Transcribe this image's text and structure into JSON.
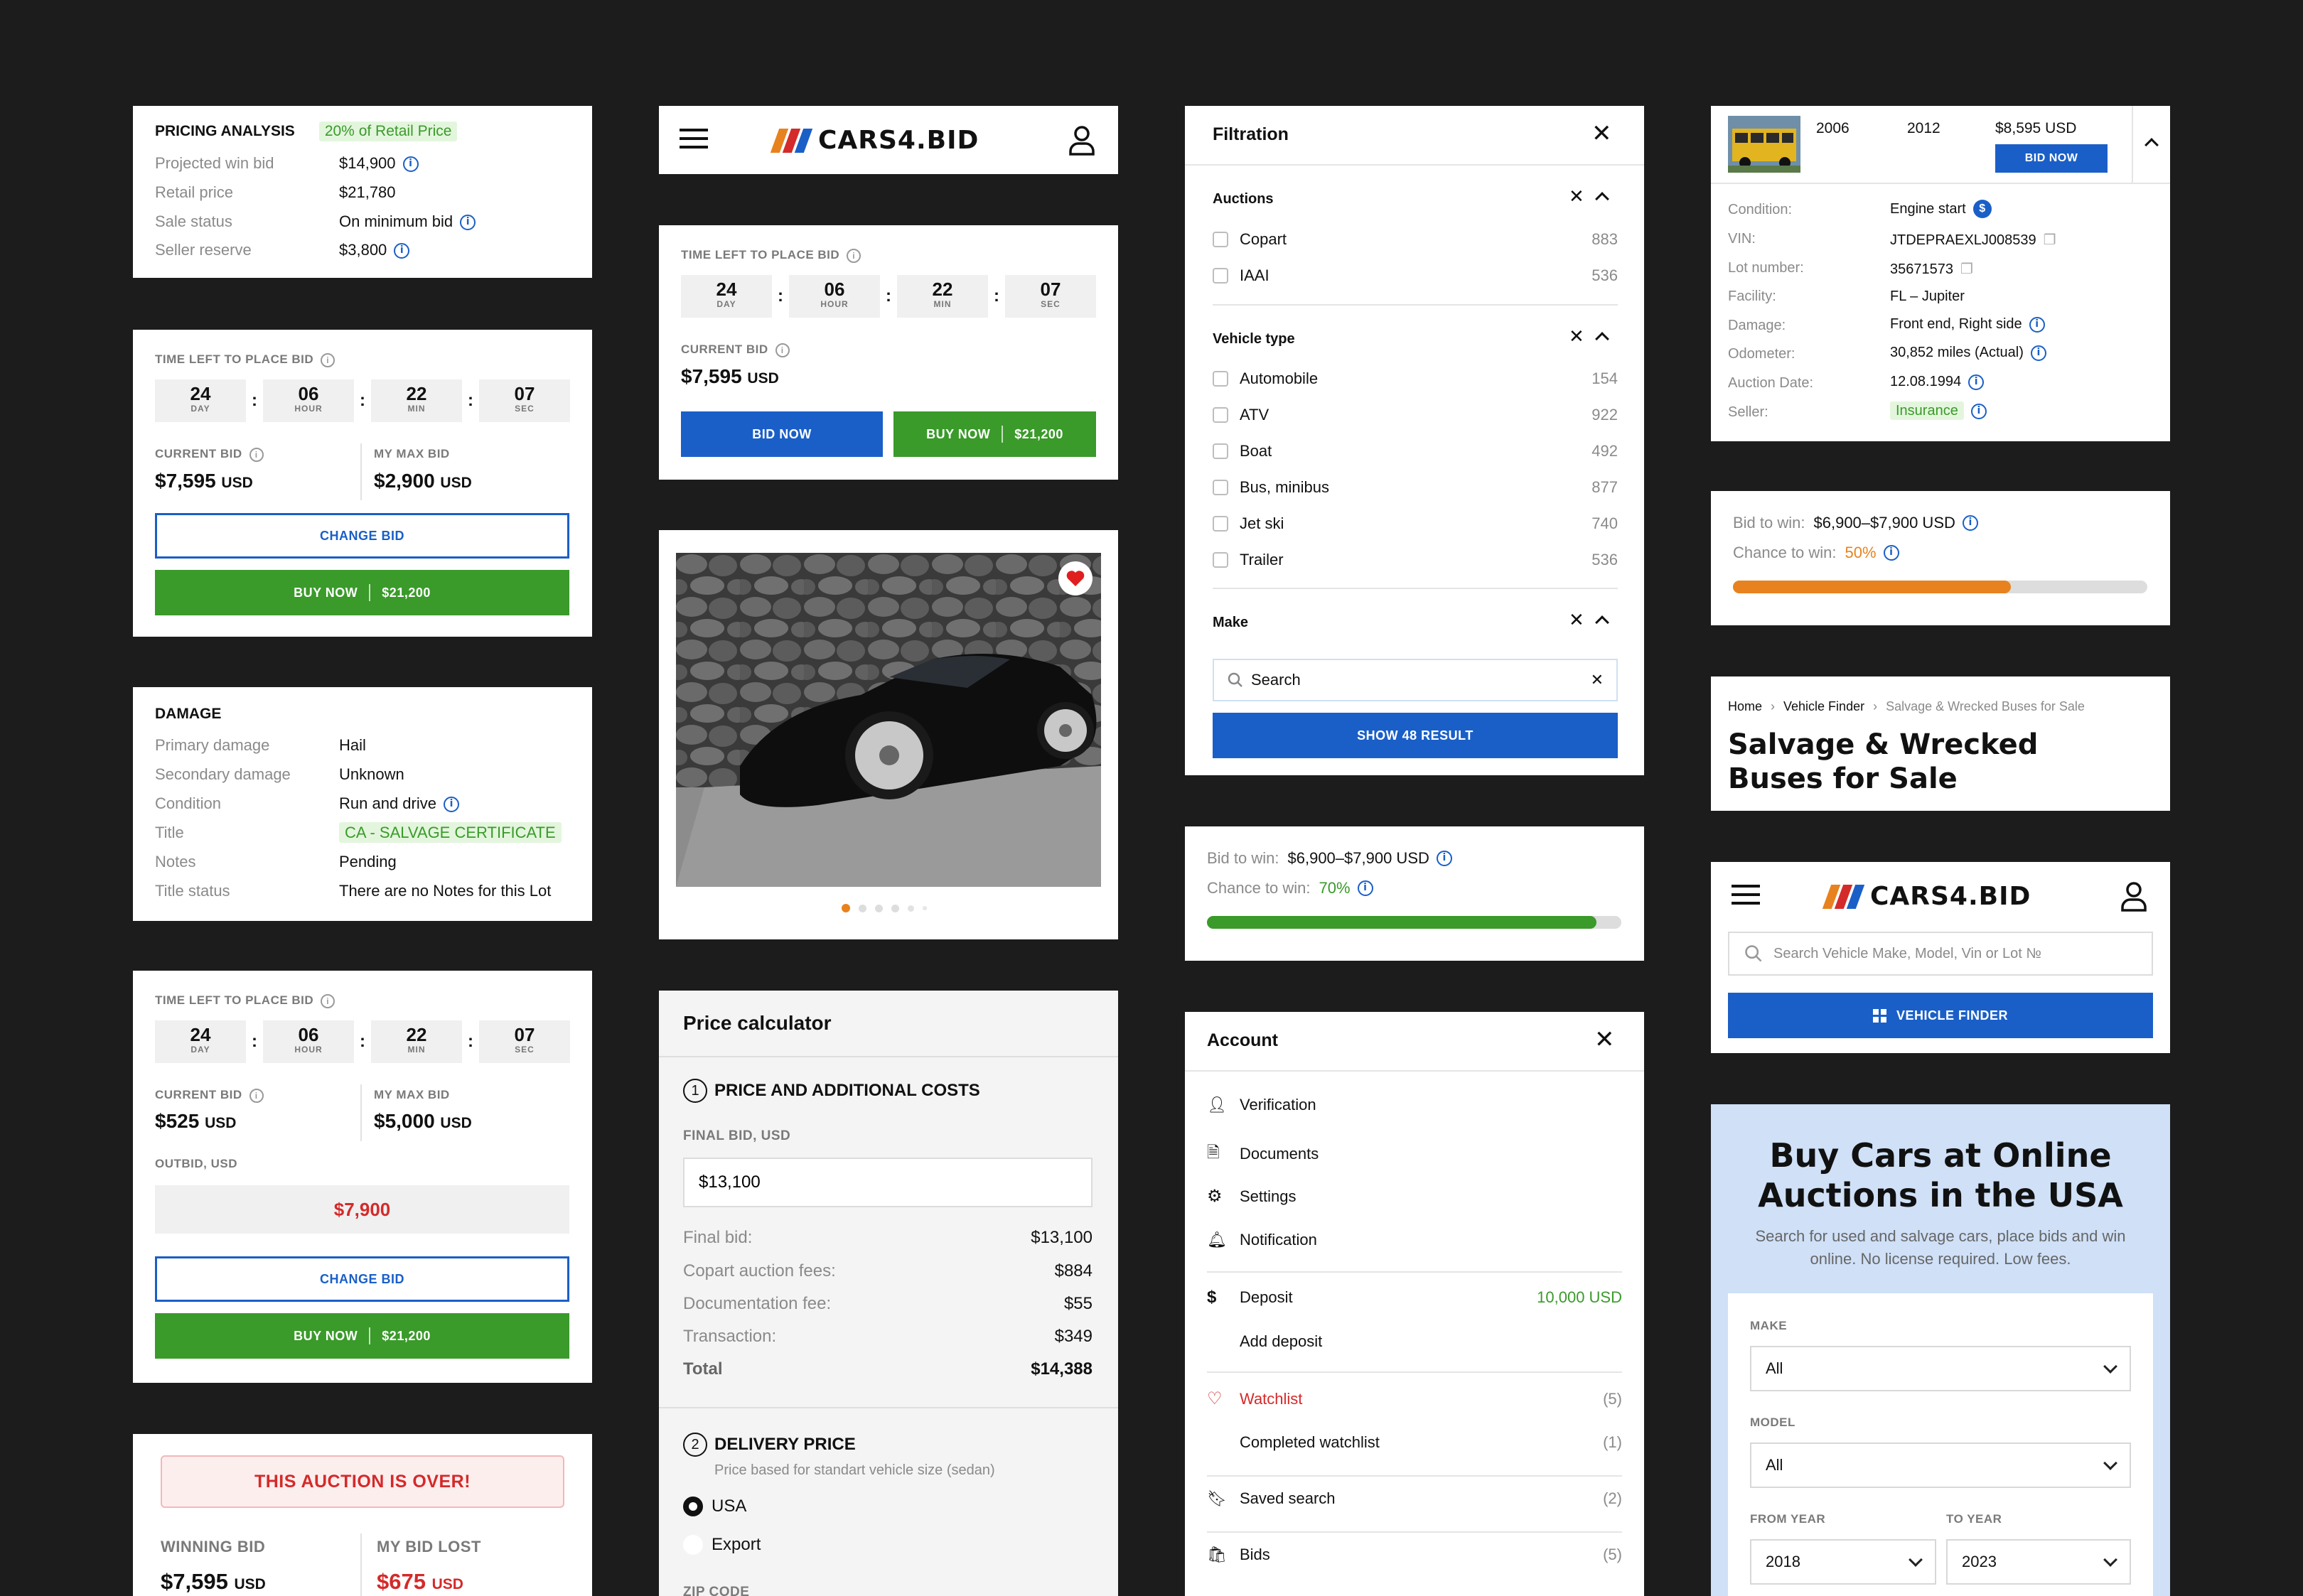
{
  "pricing": {
    "title": "PRICING ANALYSIS",
    "badge": "20% of Retail Price",
    "rows": [
      {
        "k": "Projected win bid",
        "v": "$14,900"
      },
      {
        "k": "Retail price",
        "v": "$21,780"
      },
      {
        "k": "Sale status",
        "v": "On minimum bid"
      },
      {
        "k": "Seller reserve",
        "v": "$3,800"
      }
    ]
  },
  "timer1": {
    "label": "TIME LEFT TO PLACE BID",
    "day": "24",
    "hour": "06",
    "min": "22",
    "sec": "07",
    "u_day": "DAY",
    "u_hour": "HOUR",
    "u_min": "MIN",
    "u_sec": "SEC",
    "current_label": "CURRENT BID",
    "current": "$7,595",
    "max_label": "MY MAX BID",
    "max": "$2,900",
    "cur": "USD",
    "change": "CHANGE BID",
    "buy": "BUY NOW",
    "buy_price": "$21,200"
  },
  "damage": {
    "title": "DAMAGE",
    "rows": [
      {
        "k": "Primary damage",
        "v": "Hail"
      },
      {
        "k": "Secondary damage",
        "v": "Unknown"
      },
      {
        "k": "Condition",
        "v": "Run and drive"
      },
      {
        "k": "Title",
        "v": "CA - SALVAGE CERTIFICATE"
      },
      {
        "k": "Notes",
        "v": "Pending"
      },
      {
        "k": "Title status",
        "v": "There are no Notes for this Lot"
      }
    ]
  },
  "timer2": {
    "label": "TIME LEFT TO PLACE BID",
    "day": "24",
    "hour": "06",
    "min": "22",
    "sec": "07",
    "current_label": "CURRENT BID",
    "current": "$525",
    "max_label": "MY MAX BID",
    "max": "$5,000",
    "cur": "USD",
    "outbid_label": "OUTBID, USD",
    "outbid": "$7,900",
    "change": "CHANGE BID",
    "buy": "BUY NOW",
    "buy_price": "$21,200"
  },
  "over": {
    "banner": "THIS AUCTION IS OVER!",
    "winning_label": "WINNING BID",
    "winning": "$7,595",
    "lost_label": "MY BID LOST",
    "lost": "$675",
    "cur": "USD"
  },
  "header1": {
    "logo": "CARS4.BID"
  },
  "timer3": {
    "label": "TIME LEFT TO PLACE BID",
    "day": "24",
    "hour": "06",
    "min": "22",
    "sec": "07",
    "current_label": "CURRENT BID",
    "current": "$7,595",
    "cur": "USD",
    "bid": "BID NOW",
    "buy": "BUY NOW",
    "buy_price": "$21,200"
  },
  "calc": {
    "title": "Price calculator",
    "s1num": "1",
    "s1": "PRICE AND ADDITIONAL COSTS",
    "final_label": "FINAL BID, USD",
    "final_value": "$13,100",
    "rows": [
      {
        "k": "Final bid:",
        "v": "$13,100"
      },
      {
        "k": "Copart auction fees:",
        "v": "$884"
      },
      {
        "k": "Documentation fee:",
        "v": "$55"
      },
      {
        "k": "Transaction:",
        "v": "$349"
      }
    ],
    "total_k": "Total",
    "total_v": "$14,388",
    "s2num": "2",
    "s2": "DELIVERY PRICE",
    "s2sub": "Price based for standart vehicle size (sedan)",
    "opt1": "USA",
    "opt2": "Export",
    "zip": "ZIP CODE"
  },
  "filter": {
    "title": "Filtration",
    "auctions": "Auctions",
    "auction_items": [
      {
        "l": "Copart",
        "c": "883"
      },
      {
        "l": "IAAI",
        "c": "536"
      }
    ],
    "vtype": "Vehicle type",
    "vtype_items": [
      {
        "l": "Automobile",
        "c": "154"
      },
      {
        "l": "ATV",
        "c": "922"
      },
      {
        "l": "Boat",
        "c": "492"
      },
      {
        "l": "Bus, minibus",
        "c": "877"
      },
      {
        "l": "Jet ski",
        "c": "740"
      },
      {
        "l": "Trailer",
        "c": "536"
      }
    ],
    "make": "Make",
    "search": "Search",
    "show": "SHOW 48 RESULT"
  },
  "chance1": {
    "bid_label": "Bid to win:",
    "bid": "$6,900–$7,900 USD",
    "chance_label": "Chance to win:",
    "chance": "70%",
    "progress": 0.94
  },
  "account": {
    "title": "Account",
    "items": [
      {
        "l": "Verification"
      },
      {
        "l": "Documents"
      },
      {
        "l": "Settings"
      },
      {
        "l": "Notification"
      }
    ],
    "deposit": "Deposit",
    "deposit_v": "10,000 USD",
    "add_deposit": "Add deposit",
    "watchlist": "Watchlist",
    "watch_c": "(5)",
    "completed": "Completed watchlist",
    "completed_c": "(1)",
    "saved": "Saved search",
    "saved_c": "(2)",
    "bids": "Bids",
    "bids_c": "(5)"
  },
  "lot": {
    "year1": "2006",
    "year2": "2012",
    "price": "$8,595 USD",
    "bid": "BID NOW",
    "rows": [
      {
        "k": "Condition:",
        "v": "Engine start"
      },
      {
        "k": "VIN:",
        "v": "JTDEPRAEXLJ008539"
      },
      {
        "k": "Lot number:",
        "v": "35671573"
      },
      {
        "k": "Facility:",
        "v": "FL – Jupiter"
      },
      {
        "k": "Damage:",
        "v": "Front end, Right side"
      },
      {
        "k": "Odometer:",
        "v": "30,852 miles (Actual)"
      },
      {
        "k": "Auction Date:",
        "v": "12.08.1994"
      },
      {
        "k": "Seller:",
        "v": "Insurance"
      }
    ]
  },
  "chance2": {
    "bid_label": "Bid to win:",
    "bid": "$6,900–$7,900 USD",
    "chance_label": "Chance to win:",
    "chance": "50%",
    "progress": 0.67
  },
  "crumb": {
    "home": "Home",
    "finder": "Vehicle Finder",
    "current": "Salvage & Wrecked Buses for Sale",
    "title": "Salvage & Wrecked Buses for Sale"
  },
  "header2": {
    "logo": "CARS4.BID",
    "search": "Search Vehicle Make, Model, Vin or Lot №",
    "finder": "VEHICLE FINDER"
  },
  "hero": {
    "title": "Buy Cars at Online Auctions in the USA",
    "sub": "Search for used and salvage cars, place bids and win online. No license required. Low fees.",
    "make_label": "MAKE",
    "make": "All",
    "model_label": "MODEL",
    "model": "All",
    "from_label": "FROM YEAR",
    "from": "2018",
    "to_label": "TO YEAR",
    "to": "2023"
  },
  "colors": {
    "blue": "#1a5fc7",
    "green": "#3a9a2a",
    "red": "#d42a2a",
    "orange": "#e8821e"
  }
}
